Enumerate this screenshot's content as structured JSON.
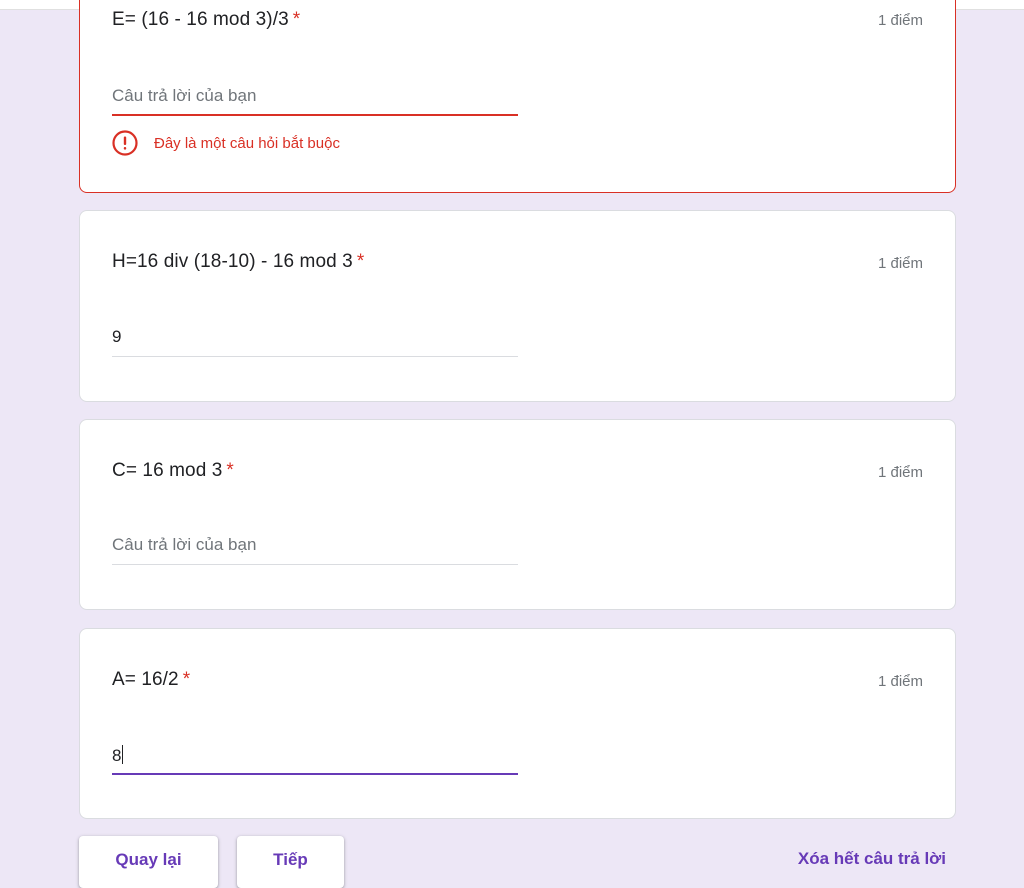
{
  "questions": [
    {
      "title": "E= (16 - 16 mod 3)/3",
      "required_mark": "*",
      "points": "1 điểm",
      "answer_value": "",
      "placeholder": "Câu trả lời của bạn",
      "error_message": "Đây là một câu hỏi bắt buộc"
    },
    {
      "title": "H=16 div (18-10) - 16 mod 3",
      "required_mark": "*",
      "points": "1 điểm",
      "answer_value": "9",
      "placeholder": "Câu trả lời của bạn"
    },
    {
      "title": "C= 16 mod 3",
      "required_mark": "*",
      "points": "1 điểm",
      "answer_value": "",
      "placeholder": "Câu trả lời của bạn"
    },
    {
      "title": "A= 16/2",
      "required_mark": "*",
      "points": "1 điểm",
      "answer_value": "8",
      "placeholder": "Câu trả lời của bạn"
    }
  ],
  "footer": {
    "back_label": "Quay lại",
    "next_label": "Tiếp",
    "clear_label": "Xóa hết câu trả lời"
  },
  "colors": {
    "accent": "#673ab7",
    "error": "#d93025",
    "background": "#ede7f6"
  },
  "icons": {
    "error": "error-circle-icon"
  }
}
